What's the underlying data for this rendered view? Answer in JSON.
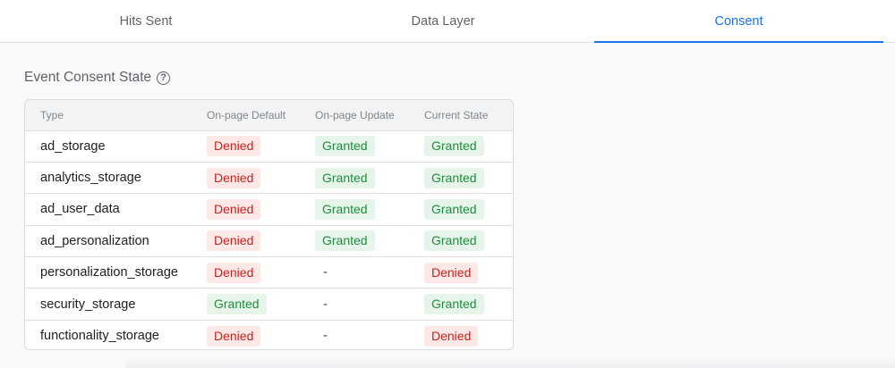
{
  "tabs": [
    {
      "label": "Hits Sent",
      "active": false
    },
    {
      "label": "Data Layer",
      "active": false
    },
    {
      "label": "Consent",
      "active": true
    }
  ],
  "section": {
    "title": "Event Consent State",
    "help_icon": "help-circle-icon"
  },
  "table": {
    "headers": [
      "Type",
      "On-page Default",
      "On-page Update",
      "Current State"
    ],
    "rows": [
      {
        "type": "ad_storage",
        "default": "Denied",
        "update": "Granted",
        "current": "Granted"
      },
      {
        "type": "analytics_storage",
        "default": "Denied",
        "update": "Granted",
        "current": "Granted"
      },
      {
        "type": "ad_user_data",
        "default": "Denied",
        "update": "Granted",
        "current": "Granted"
      },
      {
        "type": "ad_personalization",
        "default": "Denied",
        "update": "Granted",
        "current": "Granted"
      },
      {
        "type": "personalization_storage",
        "default": "Denied",
        "update": "-",
        "current": "Denied"
      },
      {
        "type": "security_storage",
        "default": "Granted",
        "update": "-",
        "current": "Granted"
      },
      {
        "type": "functionality_storage",
        "default": "Denied",
        "update": "-",
        "current": "Denied"
      }
    ]
  },
  "colors": {
    "accent": "#1a73e8",
    "denied_bg": "#fce8e6",
    "denied_text": "#c5221f",
    "granted_bg": "#e6f4ea",
    "granted_text": "#1e8e3e"
  }
}
